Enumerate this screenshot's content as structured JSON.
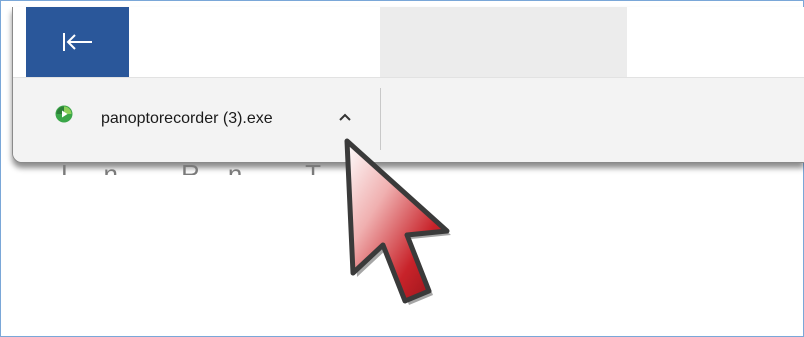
{
  "download_bar": {
    "items": [
      {
        "filename": "panoptorecorder (3).exe",
        "icon": "panopto-recorder-icon",
        "menu_icon": "chevron-up-icon"
      }
    ]
  },
  "tabs": {
    "back_icon": "back-arrow-icon"
  },
  "page": {
    "partial_text": "Ln Rn Tn"
  },
  "colors": {
    "back_tab": "#2a579a",
    "cursor_fill": "#c8232a",
    "panopto_green": "#3aa648",
    "frame_border": "#7aa7d8"
  }
}
